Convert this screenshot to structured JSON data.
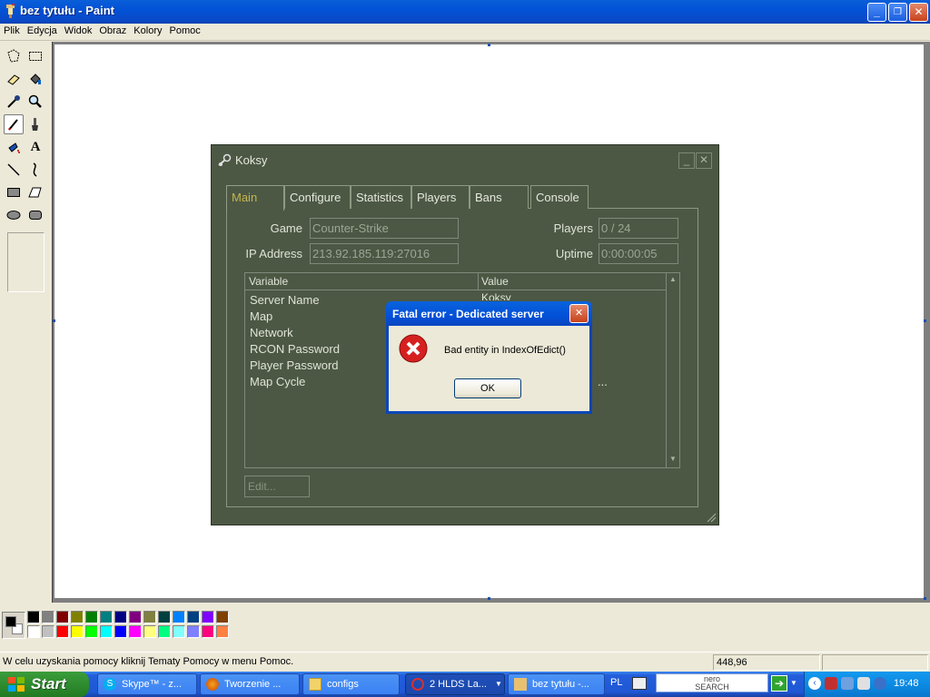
{
  "window": {
    "title": "bez tytułu - Paint",
    "controls": {
      "minimize": "_",
      "maximize": "❐",
      "close": "✕"
    }
  },
  "menu": [
    "Plik",
    "Edycja",
    "Widok",
    "Obraz",
    "Kolory",
    "Pomoc"
  ],
  "tools": [
    "free-select",
    "rect-select",
    "eraser",
    "fill",
    "color-picker",
    "magnifier",
    "pencil",
    "brush",
    "airbrush",
    "text",
    "line",
    "curve",
    "rectangle",
    "polygon",
    "ellipse",
    "rounded-rectangle"
  ],
  "selected_tool": "pencil",
  "palette": {
    "top": [
      "#000000",
      "#808080",
      "#800000",
      "#808000",
      "#008000",
      "#008080",
      "#000080",
      "#800080",
      "#808040",
      "#004040",
      "#0080ff",
      "#004080",
      "#8000ff",
      "#804000"
    ],
    "bottom": [
      "#ffffff",
      "#c0c0c0",
      "#ff0000",
      "#ffff00",
      "#00ff00",
      "#00ffff",
      "#0000ff",
      "#ff00ff",
      "#ffff80",
      "#00ff80",
      "#80ffff",
      "#8080ff",
      "#ff0080",
      "#ff8040"
    ],
    "foreground": "#000000",
    "background": "#ffffff"
  },
  "status": {
    "help": "W celu uzyskania pomocy kliknij Tematy Pomocy w menu Pomoc.",
    "coords": "448,96"
  },
  "steam_dialog": {
    "title": "Koksy",
    "tabs": [
      "Main",
      "Configure",
      "Statistics",
      "Players",
      "Bans",
      "Console"
    ],
    "active_tab": "Main",
    "game_label": "Game",
    "game_value": "Counter-Strike",
    "ip_label": "IP Address",
    "ip_value": "213.92.185.119:27016",
    "players_label": "Players",
    "players_value": "0 / 24",
    "uptime_label": "Uptime",
    "uptime_value": "0:00:00:05",
    "list_headers": [
      "Variable",
      "Value"
    ],
    "variables": [
      "Server Name",
      "Map",
      "Network",
      "RCON Password",
      "Player Password",
      "Map Cycle"
    ],
    "partial_value": "Koksy",
    "ellipsis": "...",
    "edit_button": "Edit..."
  },
  "error_dialog": {
    "title": "Fatal error - Dedicated server",
    "message": "Bad entity in IndexOfEdict()",
    "ok": "OK"
  },
  "taskbar": {
    "start": "Start",
    "tasks": [
      "Skype™ - z...",
      "Tworzenie ...",
      "configs",
      "2 HLDS La...",
      "bez tytułu -..."
    ],
    "lang": "PL",
    "nero": "nero\nSEARCH",
    "clock": "19:48"
  }
}
